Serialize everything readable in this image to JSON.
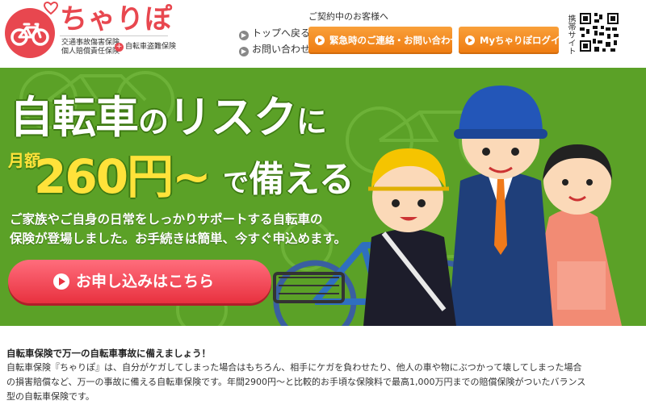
{
  "header": {
    "brand": "ちゃりぽ",
    "brand_sub_lines": [
      "交通事故傷害保険",
      "個人賠償責任保険"
    ],
    "brand_badge": "自転車盗難保険",
    "nav": {
      "top_link": "トップへ戻る",
      "contact_link": "お問い合わせ"
    },
    "customer_label": "ご契約中のお客様へ",
    "emergency_button": "緊急時のご連絡・お問い合わせ",
    "login_button": "Myちゃりぽログイン",
    "mobile_site_label": "携帯サイト"
  },
  "hero": {
    "title_main_1": "自転車",
    "title_small_1": "の",
    "title_main_2": "リスク",
    "title_small_2": "に",
    "price_prefix": "月額",
    "price_amount": "260円~",
    "price_rest_small": "で",
    "price_rest_main": "備える",
    "description_lines": [
      "ご家族やご自身の日常をしっかりサポートする自転車の",
      "保険が登場しました。お手続きは簡単、今すぐ申込めます。"
    ],
    "apply_button": "お申し込みはこちら"
  },
  "content": {
    "heading": "自転車保険で万一の自転車事故に備えましょう！",
    "body_lines": [
      "自転車保険『ちゃりぽ』は、自分がケガしてしまった場合はもちろん、相手にケガを負わせたり、他人の車や物にぶつかって壊してしまった場合",
      "の損害賠償など、万一の事故に備える自転車保険です。年間2900円～と比較的お手頃な保険料で最高1,000万円までの賠償保険がついたバランス",
      "型の自転車保険です。"
    ]
  },
  "colors": {
    "brand_red": "#e8474f",
    "header_button_orange": "#ee7a0f",
    "hero_green": "#5ba127",
    "price_yellow": "#ffe23a",
    "apply_button_red": "#e8313f"
  },
  "icons": {
    "logo": "bicycle-heart-icon",
    "nav_arrow": "circle-arrow-right-icon",
    "button_play": "play-circle-icon",
    "qr": "qr-code-icon"
  }
}
